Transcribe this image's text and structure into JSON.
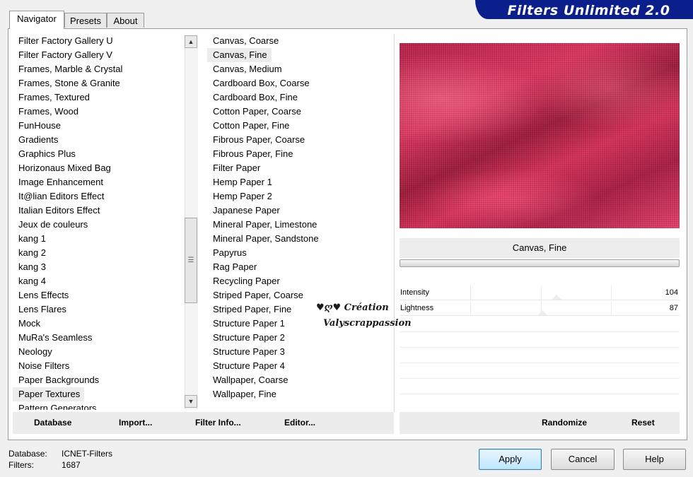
{
  "banner": {
    "title": "Filters Unlimited 2.0"
  },
  "tabs": [
    {
      "label": "Navigator",
      "active": true
    },
    {
      "label": "Presets",
      "active": false
    },
    {
      "label": "About",
      "active": false
    }
  ],
  "categories": {
    "items": [
      "Filter Factory Gallery U",
      "Filter Factory Gallery V",
      "Frames, Marble & Crystal",
      "Frames, Stone & Granite",
      "Frames, Textured",
      "Frames, Wood",
      "FunHouse",
      "Gradients",
      "Graphics Plus",
      "Horizonaus Mixed Bag",
      "Image Enhancement",
      "It@lian Editors Effect",
      "Italian Editors Effect",
      "Jeux de couleurs",
      "kang 1",
      "kang 2",
      "kang 3",
      "kang 4",
      "Lens Effects",
      "Lens Flares",
      "Mock",
      "MuRa's Seamless",
      "Neology",
      "Noise Filters",
      "Paper Backgrounds",
      "Paper Textures",
      "Pattern Generators"
    ],
    "selected_index": 25
  },
  "filters": {
    "items": [
      "Canvas, Coarse",
      "Canvas, Fine",
      "Canvas, Medium",
      "Cardboard Box, Coarse",
      "Cardboard Box, Fine",
      "Cotton Paper, Coarse",
      "Cotton Paper, Fine",
      "Fibrous Paper, Coarse",
      "Fibrous Paper, Fine",
      "Filter Paper",
      "Hemp Paper 1",
      "Hemp Paper 2",
      "Japanese Paper",
      "Mineral Paper, Limestone",
      "Mineral Paper, Sandstone",
      "Papyrus",
      "Rag Paper",
      "Recycling Paper",
      "Striped Paper, Coarse",
      "Striped Paper, Fine",
      "Structure Paper 1",
      "Structure Paper 2",
      "Structure Paper 3",
      "Structure Paper 4",
      "Wallpaper, Coarse",
      "Wallpaper, Fine"
    ],
    "selected_index": 1
  },
  "preview": {
    "filter_name": "Canvas, Fine",
    "colors": {
      "base": "#c9284f",
      "dark": "#9c1c3b",
      "light": "#e2406a"
    }
  },
  "sliders": [
    {
      "label": "Intensity",
      "value": "104",
      "max": 255
    },
    {
      "label": "Lightness",
      "value": "87",
      "max": 255
    }
  ],
  "watermark": {
    "line1": "♥ღ♥ Création",
    "line2": "Valyscrappassion"
  },
  "left_buttons": {
    "database": "Database",
    "import": "Import...",
    "filter_info": "Filter Info...",
    "editor": "Editor..."
  },
  "right_buttons": {
    "randomize": "Randomize",
    "reset": "Reset"
  },
  "status": {
    "database_label": "Database:",
    "database_value": "ICNET-Filters",
    "filters_label": "Filters:",
    "filters_value": "1687"
  },
  "dialog_buttons": {
    "apply": "Apply",
    "cancel": "Cancel",
    "help": "Help"
  }
}
